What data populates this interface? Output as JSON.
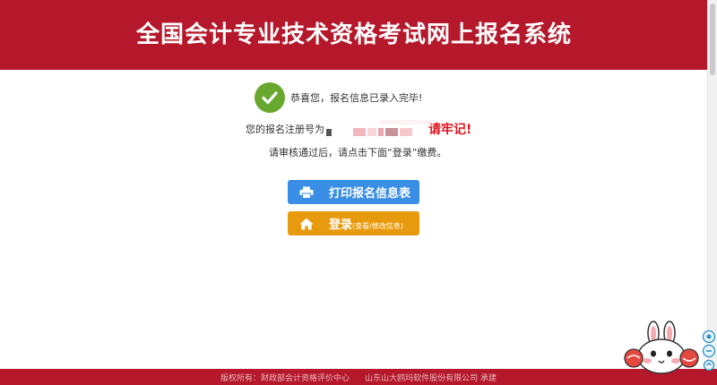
{
  "header": {
    "title": "全国会计专业技术资格考试网上报名系统"
  },
  "result": {
    "success_message": "恭喜您，报名信息已录入完毕!",
    "registration_label": "您的报名注册号为",
    "registration_number_masked": true,
    "remember_text": "请牢记!",
    "hint": "请审核通过后，请点击下面“登录”缴费。"
  },
  "buttons": {
    "print_label": "打印报名信息表",
    "login_label": "登录",
    "login_sub": "(查看/修改信息)"
  },
  "footer": {
    "copyright": "版权所有：财政部会计资格评价中心",
    "undertaker": "山东山大鸥玛软件股份有限公司 承建"
  },
  "colors": {
    "header_red": "#b5182b",
    "success_green": "#69a82e",
    "print_blue": "#3a8ee6",
    "login_orange": "#e89a0e",
    "remember_red": "#e0141e"
  },
  "icons": {
    "success": "check-circle-icon",
    "print": "printer-icon",
    "login": "home-icon"
  }
}
